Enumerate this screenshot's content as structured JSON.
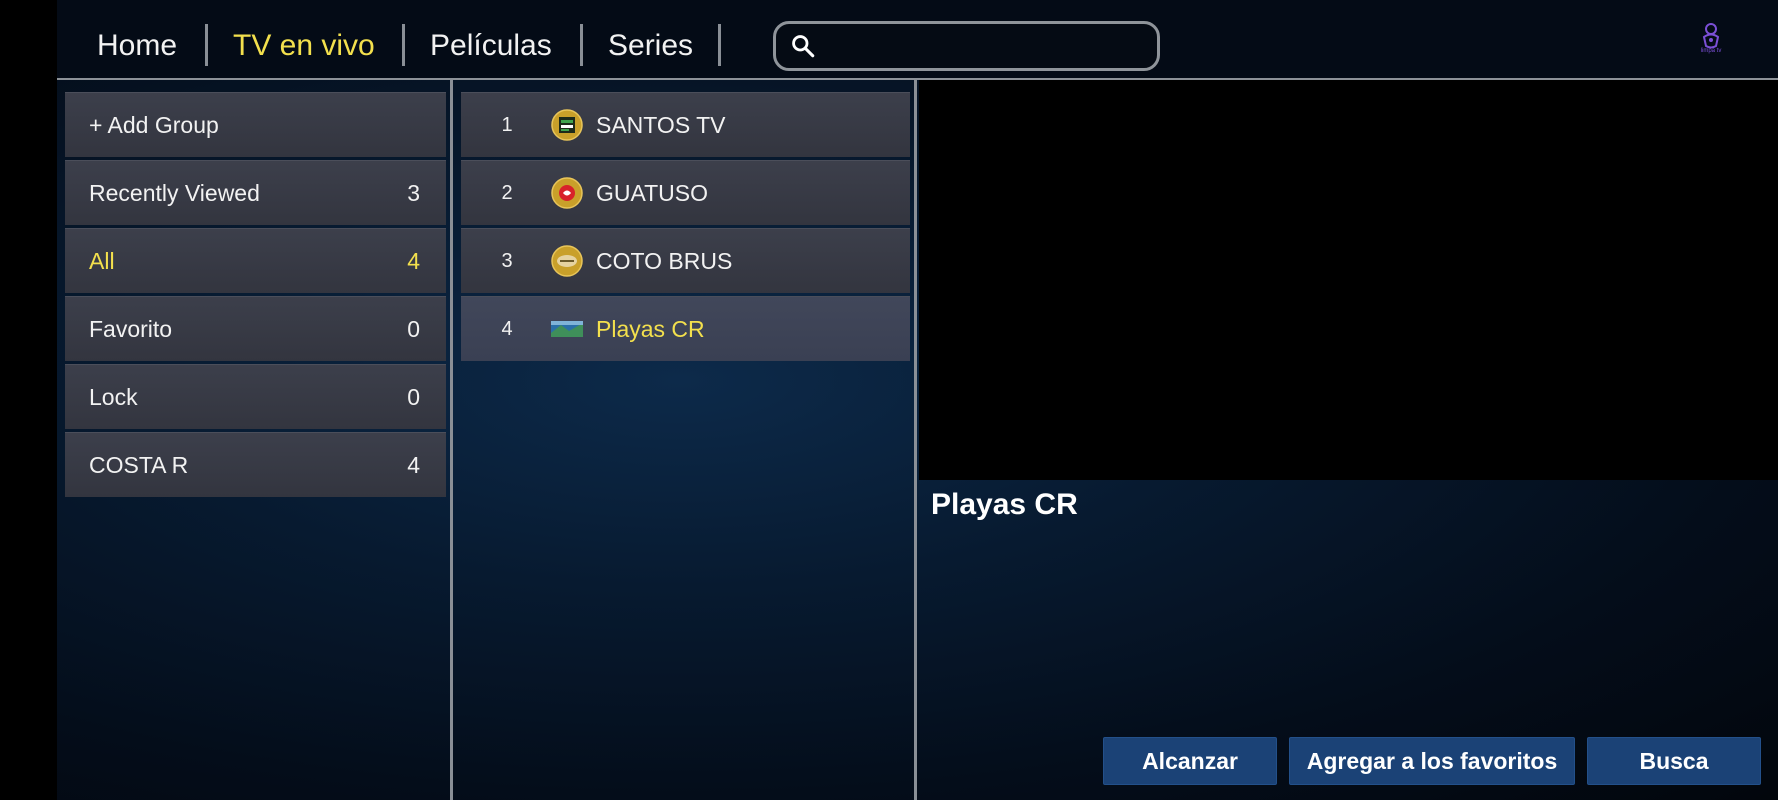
{
  "nav": {
    "tabs": [
      {
        "label": "Home"
      },
      {
        "label": "TV en vivo"
      },
      {
        "label": "Películas"
      },
      {
        "label": "Series"
      }
    ],
    "active_tab": "TV en vivo",
    "search": {
      "value": "",
      "placeholder": ""
    },
    "logo_text": "limpa tv"
  },
  "groups": [
    {
      "label": "+ Add Group",
      "count": ""
    },
    {
      "label": "Recently Viewed",
      "count": "3"
    },
    {
      "label": "All",
      "count": "4"
    },
    {
      "label": "Favorito",
      "count": "0"
    },
    {
      "label": "Lock",
      "count": "0"
    },
    {
      "label": "COSTA R",
      "count": "4"
    }
  ],
  "channels": [
    {
      "num": "1",
      "name": "SANTOS TV",
      "icon": "santos-tv-logo"
    },
    {
      "num": "2",
      "name": "GUATUSO",
      "icon": "guatuso-logo"
    },
    {
      "num": "3",
      "name": "COTO BRUS",
      "icon": "coto-brus-logo"
    },
    {
      "num": "4",
      "name": "Playas CR",
      "icon": "playas-cr-thumbnail"
    }
  ],
  "now_playing": {
    "title": "Playas CR"
  },
  "actions": {
    "reach": "Alcanzar",
    "add_favorite": "Agregar a los favoritos",
    "search": "Busca"
  },
  "colors": {
    "accent": "#f3e04d",
    "button": "#1b4276",
    "item_bg": "#3a3c47"
  }
}
